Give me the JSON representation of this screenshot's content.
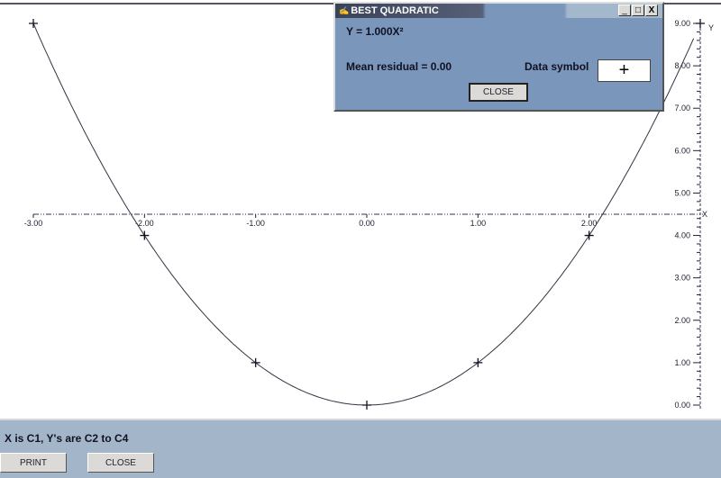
{
  "chart_data": {
    "type": "scatter",
    "title": "",
    "xlabel": "X",
    "ylabel": "Y",
    "xlim": [
      -3,
      3
    ],
    "ylim": [
      0,
      9
    ],
    "x_ticks": [
      "-3.00",
      "-2.00",
      "-1.00",
      "0.00",
      "1.00",
      "2.00"
    ],
    "y_ticks": [
      "0.00",
      "1.00",
      "2.00",
      "3.00",
      "4.00",
      "5.00",
      "6.00",
      "7.00",
      "8.00",
      "9.00"
    ],
    "x_axis_at_y": 4.5,
    "points": {
      "x": [
        -3,
        -2,
        -1,
        0,
        1,
        2,
        3
      ],
      "y": [
        9,
        4,
        1,
        0,
        1,
        4,
        9
      ]
    },
    "fit": {
      "type": "quadratic",
      "a": 1.0,
      "b": 0,
      "c": 0
    }
  },
  "dialog": {
    "title": "BEST QUADRATIC",
    "equation": "Y = 1.000X²",
    "residual": "Mean residual = 0.00",
    "symbol_label": "Data symbol",
    "symbol": "+",
    "close": "CLOSE",
    "min": "_",
    "max": "□",
    "x": "X"
  },
  "footer": {
    "status": "X is C1, Y's are C2 to C4",
    "print": "PRINT",
    "close": "CLOSE"
  }
}
